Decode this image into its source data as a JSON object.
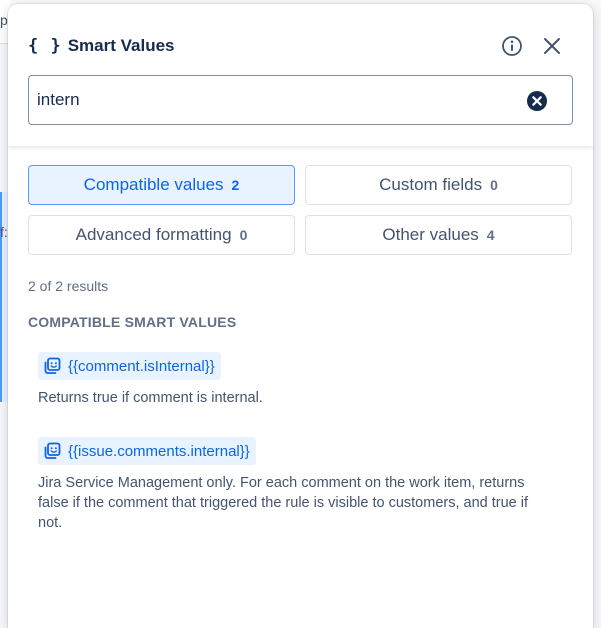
{
  "header": {
    "icon_glyph": "{ }",
    "title": "Smart Values",
    "info_icon": "info-icon",
    "close_icon": "close-icon"
  },
  "search": {
    "value": "intern",
    "clear_icon": "clear-icon"
  },
  "background": {
    "top_char": "p",
    "mid_char": "f:"
  },
  "tabs": [
    {
      "label": "Compatible values",
      "count": "2",
      "active": true
    },
    {
      "label": "Custom fields",
      "count": "0",
      "active": false
    },
    {
      "label": "Advanced formatting",
      "count": "0",
      "active": false
    },
    {
      "label": "Other values",
      "count": "4",
      "active": false
    }
  ],
  "results_text": "2 of 2 results",
  "section_heading": "COMPATIBLE SMART VALUES",
  "items": [
    {
      "code": "{{comment.isInternal}}",
      "description": "Returns true if comment is internal."
    },
    {
      "code": "{{issue.comments.internal}}",
      "description": "Jira Service Management only. For each comment on the work item, returns false if the comment that triggered the rule is visible to customers, and true if not."
    }
  ],
  "colors": {
    "accent": "#0c66e4",
    "accent_bg": "#e9f2ff",
    "text": "#172b4d",
    "muted": "#626f86"
  }
}
